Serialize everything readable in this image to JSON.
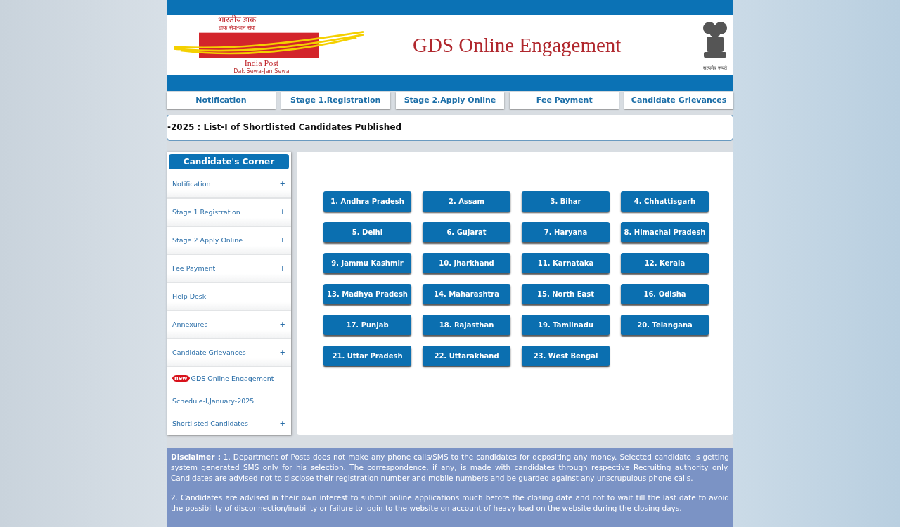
{
  "header": {
    "logo_hindi": "भारतीय डाक",
    "logo_hindi_tagline": "डाक सेवा-जन सेवा",
    "logo_name": "India Post",
    "logo_tagline": "Dak Sewa-Jan Sewa",
    "title": "GDS Online Engagement",
    "emblem_caption": "सत्यमेव जयते"
  },
  "nav": [
    "Notification",
    "Stage 1.Registration",
    "Stage 2.Apply Online",
    "Fee Payment",
    "Candidate Grievances"
  ],
  "ticker": "-2025 : List-I of Shortlisted Candidates Published",
  "sidebar": {
    "title": "Candidate's Corner",
    "items": [
      {
        "label": "Notification",
        "expandable": true
      },
      {
        "label": "Stage 1.Registration",
        "expandable": true
      },
      {
        "label": "Stage 2.Apply Online",
        "expandable": true
      },
      {
        "label": "Fee Payment",
        "expandable": true
      },
      {
        "label": "Help Desk",
        "expandable": false
      },
      {
        "label": "Annexures",
        "expandable": true
      },
      {
        "label": "Candidate Grievances",
        "expandable": true
      }
    ],
    "news": {
      "badge": "new",
      "line1": "GDS Online Engagement",
      "line2": "Schedule-I,January-2025",
      "line3": "Shortlisted Candidates",
      "expandable": true
    },
    "expand_symbol": "+"
  },
  "states": [
    "1. Andhra Pradesh",
    "2. Assam",
    "3. Bihar",
    "4. Chhattisgarh",
    "5. Delhi",
    "6. Gujarat",
    "7. Haryana",
    "8. Himachal Pradesh",
    "9. Jammu Kashmir",
    "10. Jharkhand",
    "11. Karnataka",
    "12. Kerala",
    "13. Madhya Pradesh",
    "14. Maharashtra",
    "15. North East",
    "16. Odisha",
    "17. Punjab",
    "18. Rajasthan",
    "19. Tamilnadu",
    "20. Telangana",
    "21. Uttar Pradesh",
    "22. Uttarakhand",
    "23. West Bengal"
  ],
  "disclaimer": [
    "**Disclaimer :** 1. Department of Posts does not make any phone calls/SMS to the candidates for depositing any money. Selected candidate is getting system generated SMS only for his selection. The correspondence, if any, is made with candidates through respective Recruiting authority only. Candidates are advised not to disclose their registration number and mobile numbers and be guarded against any unscrupulous phone calls.",
    "2. Candidates are advised in their own interest to submit online applications much before the closing date and not to wait till the last date to avoid the possibility of disconnection/inability or failure to login to the website on account of heavy load on the website during the closing days."
  ]
}
